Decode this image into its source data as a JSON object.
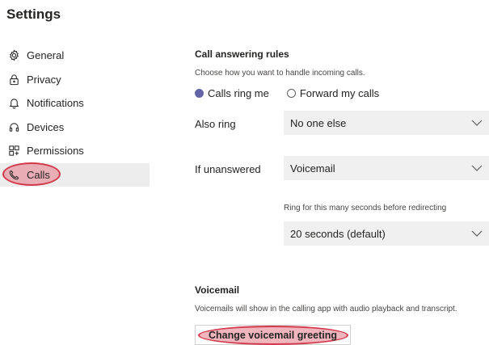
{
  "page_title": "Settings",
  "nav": {
    "items": [
      {
        "label": "General",
        "icon": "gear-icon"
      },
      {
        "label": "Privacy",
        "icon": "lock-icon"
      },
      {
        "label": "Notifications",
        "icon": "bell-icon"
      },
      {
        "label": "Devices",
        "icon": "headset-icon"
      },
      {
        "label": "Permissions",
        "icon": "permissions-grid-icon"
      },
      {
        "label": "Calls",
        "icon": "phone-icon",
        "active": true
      }
    ]
  },
  "call_answering": {
    "title": "Call answering rules",
    "description": "Choose how you want to handle incoming calls.",
    "options": [
      "Calls ring me",
      "Forward my calls"
    ],
    "selected": "Calls ring me",
    "also_ring_label": "Also ring",
    "also_ring_value": "No one else",
    "if_unanswered_label": "If unanswered",
    "if_unanswered_value": "Voicemail",
    "ring_seconds_label": "Ring for this many seconds before redirecting",
    "ring_seconds_value": "20 seconds (default)"
  },
  "voicemail": {
    "title": "Voicemail",
    "description": "Voicemails will show in the calling app with audio playback and transcript.",
    "button_label": "Change voicemail greeting"
  },
  "colors": {
    "accent": "#6264a7",
    "highlight": "#d23a4c",
    "active_nav_bg": "#ededed",
    "select_bg": "#f0f0f0"
  }
}
